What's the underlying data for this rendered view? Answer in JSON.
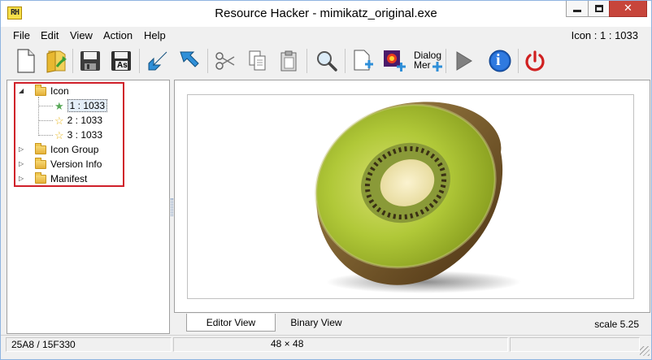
{
  "window": {
    "app_icon_text": "RH",
    "title": "Resource Hacker - mimikatz_original.exe",
    "close_symbol": "✕"
  },
  "menu": {
    "items": [
      "File",
      "Edit",
      "View",
      "Action",
      "Help"
    ],
    "status": "Icon : 1 : 1033"
  },
  "toolbar": {
    "buttons": [
      {
        "name": "new",
        "icon": "new-file-icon"
      },
      {
        "name": "open",
        "icon": "open-folder-icon"
      },
      {
        "name": "save",
        "icon": "save-icon"
      },
      {
        "name": "save-as",
        "icon": "save-as-icon",
        "label": "As"
      },
      {
        "name": "import",
        "icon": "import-arrow-icon"
      },
      {
        "name": "export",
        "icon": "export-arrow-icon"
      },
      {
        "name": "cut",
        "icon": "scissors-icon"
      },
      {
        "name": "copy",
        "icon": "copy-icon"
      },
      {
        "name": "paste",
        "icon": "paste-icon"
      },
      {
        "name": "find",
        "icon": "magnifier-icon"
      },
      {
        "name": "add-blank",
        "icon": "add-blank-resource-icon"
      },
      {
        "name": "add-image",
        "icon": "add-image-resource-icon"
      },
      {
        "name": "dialog-merger",
        "icon": "dialog-merger-icon",
        "label_line1": "Dialog",
        "label_line2": "Mer"
      },
      {
        "name": "run",
        "icon": "play-icon"
      },
      {
        "name": "info",
        "icon": "info-icon",
        "label": "i"
      },
      {
        "name": "exit",
        "icon": "power-icon"
      }
    ]
  },
  "tree": {
    "items": [
      {
        "label": "Icon",
        "expander": "◢",
        "kind": "folder"
      },
      {
        "label": "1 : 1033",
        "kind": "star",
        "selected": true
      },
      {
        "label": "2 : 1033",
        "kind": "star"
      },
      {
        "label": "3 : 1033",
        "kind": "star"
      },
      {
        "label": "Icon Group",
        "expander": "▷",
        "kind": "folder"
      },
      {
        "label": "Version Info",
        "expander": "▷",
        "kind": "folder"
      },
      {
        "label": "Manifest",
        "expander": "▷",
        "kind": "folder"
      }
    ],
    "highlight_color": "#d0202a"
  },
  "tabs": {
    "editor": "Editor View",
    "binary": "Binary View",
    "scale": "scale 5.25"
  },
  "status": {
    "offset": "25A8 / 15F330",
    "dimensions": "48 × 48"
  },
  "colors": {
    "accent": "#3b8edc",
    "close": "#c7453b",
    "kiwi_flesh": "#a6c030",
    "kiwi_skin": "#7a5a2a"
  }
}
